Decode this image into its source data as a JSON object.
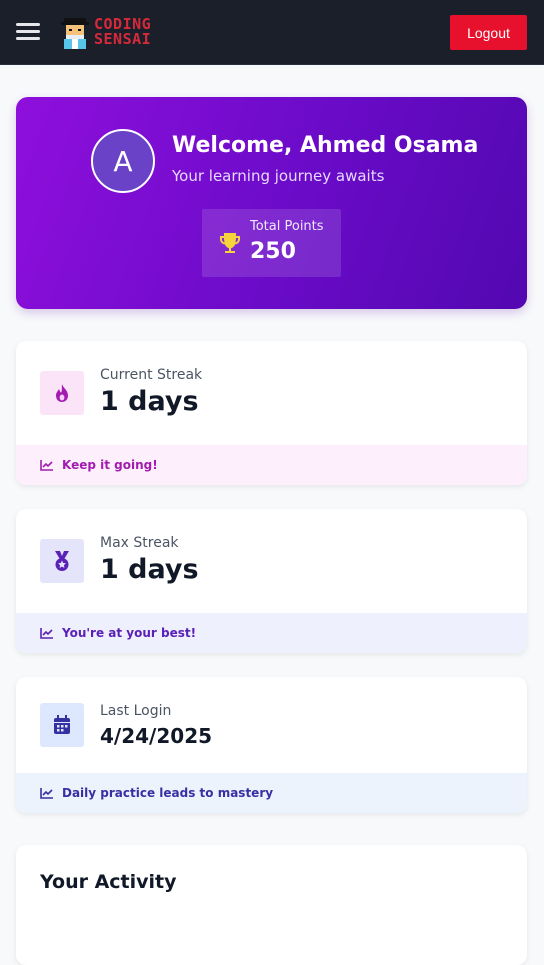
{
  "header": {
    "logo_line1": "CODING",
    "logo_line2": "SENSAI",
    "logout_label": "Logout",
    "menu_icon": "hamburger-menu-icon"
  },
  "hero": {
    "avatar_initial": "A",
    "welcome": "Welcome, Ahmed Osama",
    "subtitle": "Your learning journey awaits",
    "points_label": "Total Points",
    "points_value": "250",
    "points_icon": "trophy-icon"
  },
  "stats": {
    "current_streak": {
      "label": "Current Streak",
      "value": "1 days",
      "footer": "Keep it going!",
      "icon": "fire-icon"
    },
    "max_streak": {
      "label": "Max Streak",
      "value": "1 days",
      "footer": "You're at your best!",
      "icon": "medal-icon"
    },
    "last_login": {
      "label": "Last Login",
      "value": "4/24/2025",
      "footer": "Daily practice leads to mastery",
      "icon": "calendar-icon"
    }
  },
  "activity": {
    "title": "Your Activity"
  },
  "colors": {
    "navbar": "#1b1f2a",
    "logout": "#e8112d",
    "hero_start": "#8f0fdc",
    "hero_end": "#5208b0",
    "streak_accent": "#a21caf",
    "max_accent": "#5b21b6",
    "login_accent": "#3730a3"
  }
}
